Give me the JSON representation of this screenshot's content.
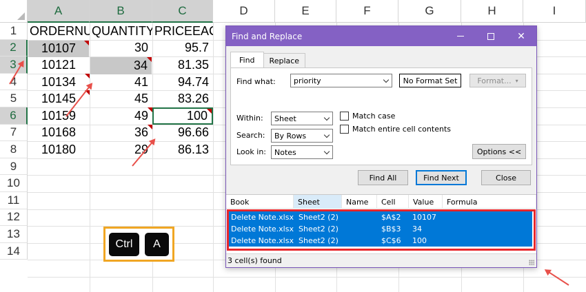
{
  "sheet": {
    "columns": [
      "A",
      "B",
      "C",
      "D",
      "E",
      "F",
      "G",
      "H",
      "I"
    ],
    "rows": [
      "1",
      "2",
      "3",
      "4",
      "5",
      "6",
      "7",
      "8",
      "9",
      "10",
      "11",
      "12",
      "13",
      "14"
    ],
    "cells": {
      "A1": "ORDERNU",
      "B1": "QUANTITY",
      "C1": "PRICEEACH",
      "A2": "10107",
      "B2": "30",
      "C2": "95.7",
      "A3": "10121",
      "B3": "34",
      "C3": "81.35",
      "A4": "10134",
      "B4": "41",
      "C4": "94.74",
      "A5": "10145",
      "B5": "45",
      "C5": "83.26",
      "A6": "10159",
      "B6": "49",
      "C6": "100",
      "A7": "10168",
      "B7": "36",
      "C7": "96.66",
      "A8": "10180",
      "B8": "29",
      "C8": "86.13"
    },
    "accent_color": "#217346",
    "note_indicator_color": "#c00000",
    "highlight_color": "#c8c8c8"
  },
  "shortcut": {
    "key1": "Ctrl",
    "key2": "A",
    "border_color": "#f0a623"
  },
  "dialog": {
    "title": "Find and Replace",
    "title_color": "#8461c4",
    "tabs": [
      "Find",
      "Replace"
    ],
    "active_tab": "Find",
    "find_what_label": "Find what:",
    "find_what_value": "priority",
    "format_status": "No Format Set",
    "format_button": "Format...",
    "within_label": "Within:",
    "within_value": "Sheet",
    "search_label": "Search:",
    "search_value": "By Rows",
    "lookin_label": "Look in:",
    "lookin_value": "Notes",
    "match_case_label": "Match case",
    "match_entire_label": "Match entire cell contents",
    "options_button": "Options <<",
    "find_all_button": "Find All",
    "find_next_button": "Find Next",
    "close_button": "Close",
    "result_headers": [
      "Book",
      "Sheet",
      "Name",
      "Cell",
      "Value",
      "Formula"
    ],
    "results": [
      {
        "book": "Delete Note.xlsx",
        "sheet": "Sheet2 (2)",
        "name": "",
        "cell": "$A$2",
        "value": "10107",
        "formula": ""
      },
      {
        "book": "Delete Note.xlsx",
        "sheet": "Sheet2 (2)",
        "name": "",
        "cell": "$B$3",
        "value": "34",
        "formula": ""
      },
      {
        "book": "Delete Note.xlsx",
        "sheet": "Sheet2 (2)",
        "name": "",
        "cell": "$C$6",
        "value": "100",
        "formula": ""
      }
    ],
    "selection_color": "#0078d7",
    "status": "3 cell(s) found"
  },
  "annotation_color": "#e8504a"
}
